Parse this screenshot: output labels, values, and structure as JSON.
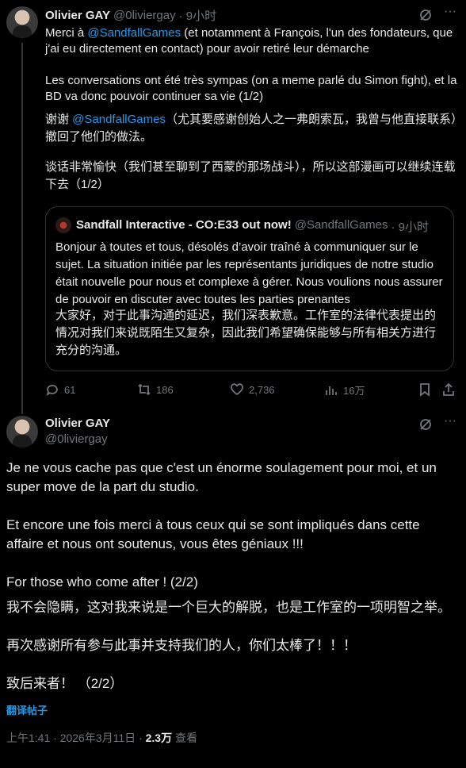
{
  "tweet1": {
    "author_name": "Olivier GAY",
    "handle": "@0liviergay",
    "time": "· 9小时",
    "text_line1_prefix": "Merci à ",
    "mention": "@SandfallGames",
    "text_line1_suffix": " (et notamment à François, l'un des fondateurs, que j'ai eu directement en contact) pour avoir retiré leur démarche",
    "text_para2": "Les conversations ont été très sympas (on a meme parlé du Simon fight), et la BD va donc pouvoir continuer sa vie (1/2)",
    "translation_prefix": "谢谢 ",
    "translation_mention": "@SandfallGames",
    "translation_suffix": "（尤其要感谢创始人之一弗朗索瓦，我曾与他直接联系）撤回了他们的做法。",
    "translation_para2": "谈话非常愉快（我们甚至聊到了西蒙的那场战斗），所以这部漫画可以继续连载下去（1/2）",
    "quote": {
      "author": "Sandfall Interactive - CO:E33 out now!",
      "handle": "@SandfallGames",
      "time": "· 9小时",
      "text": "Bonjour à toutes et tous, désolés d’avoir traîné à communiquer sur le sujet. La situation initiée par les représentants juridiques de notre studio était nouvelle pour nous et complexe à gérer. Nous voulions nous assurer de pouvoir en discuter avec toutes les parties prenantes",
      "translation": "大家好，对于此事沟通的延迟，我们深表歉意。工作室的法律代表提出的情况对我们来说既陌生又复杂，因此我们希望确保能够与所有相关方进行充分的沟通。"
    },
    "stats": {
      "replies": "61",
      "reposts": "186",
      "likes": "2,736",
      "views": "16万"
    }
  },
  "tweet2": {
    "author_name": "Olivier GAY",
    "handle": "@0liviergay",
    "para1": "Je ne vous cache pas que c'est un énorme soulagement pour moi, et un super move de la part du studio.",
    "para2": "Et encore une fois merci à tous ceux qui se sont impliqués dans cette affaire et nous ont soutenus, vous êtes géniaux !!!",
    "para3": "For those who come after ! (2/2)",
    "trans1": "我不会隐瞒，这对我来说是一个巨大的解脱，也是工作室的一项明智之举。",
    "trans2": "再次感谢所有参与此事并支持我们的人，你们太棒了！！！",
    "trans3": "致后来者！ （2/2）",
    "translate_label": "翻译帖子",
    "meta_time": "上午1:41 · 2026年3月11日 · ",
    "meta_views": "2.3万",
    "meta_views_label": " 查看"
  }
}
